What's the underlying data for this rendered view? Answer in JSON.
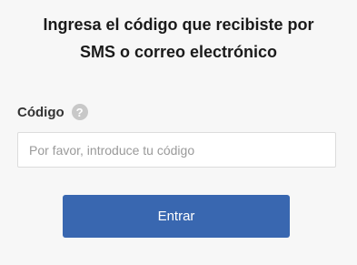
{
  "header": {
    "title_line1": "Ingresa el código que recibiste por",
    "title_line2": "SMS o correo electrónico"
  },
  "form": {
    "code_label": "Código",
    "help_icon": "question-mark-icon",
    "help_glyph": "?",
    "code_value": "",
    "code_placeholder": "Por favor, introduce tu código",
    "submit_label": "Entrar"
  },
  "colors": {
    "background": "#f7f7f7",
    "button": "#3967b0",
    "help_icon": "#c8c8c8"
  }
}
